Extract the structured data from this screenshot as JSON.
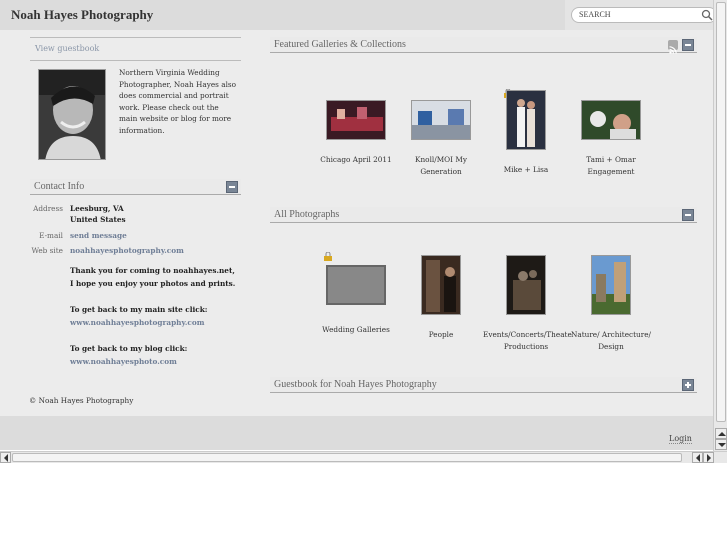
{
  "header": {
    "site_title": "Noah Hayes Photography",
    "search_placeholder": "SEARCH"
  },
  "sidebar": {
    "guestbook_link": "View guestbook",
    "bio": "Northern Virginia Wedding Photographer, Noah Hayes also does commercial and portrait work. Please check out the main website or blog for more information."
  },
  "contact": {
    "heading": "Contact Info",
    "address_label": "Address",
    "address_line1": "Leesburg, VA",
    "address_line2": "United States",
    "email_label": "E-mail",
    "email_value": "send message",
    "website_label": "Web site",
    "website_value": "noahhayesphotography.com",
    "note1": "Thank you for coming to noahhayes.net, I hope you enjoy your photos and prints.",
    "note2": "To get back to my main site click:",
    "note2_link": "www.noahhayesphotography.com",
    "note3": "To get back to my blog click:",
    "note3_link": "www.noahhayesphoto.com"
  },
  "featured": {
    "heading": "Featured Galleries & Collections",
    "items": [
      {
        "caption": "Chicago April 2011"
      },
      {
        "caption": "Knoll/MOI My Generation"
      },
      {
        "caption": "Mike + Lisa"
      },
      {
        "caption": "Tami + Omar Engagement"
      }
    ]
  },
  "all_photos": {
    "heading": "All Photographs",
    "items": [
      {
        "caption": "Wedding Galleries"
      },
      {
        "caption": "People"
      },
      {
        "caption": "Events/Concerts/Theate Productions"
      },
      {
        "caption": "Nature/ Architecture/ Design"
      }
    ]
  },
  "guestbook_section": {
    "heading": "Guestbook for Noah Hayes Photography"
  },
  "footer": {
    "copyright": "© Noah Hayes Photography",
    "login": "Login"
  },
  "colors": {
    "link": "#6f7e96",
    "toggle": "#7a8696",
    "background": "#ececec"
  }
}
